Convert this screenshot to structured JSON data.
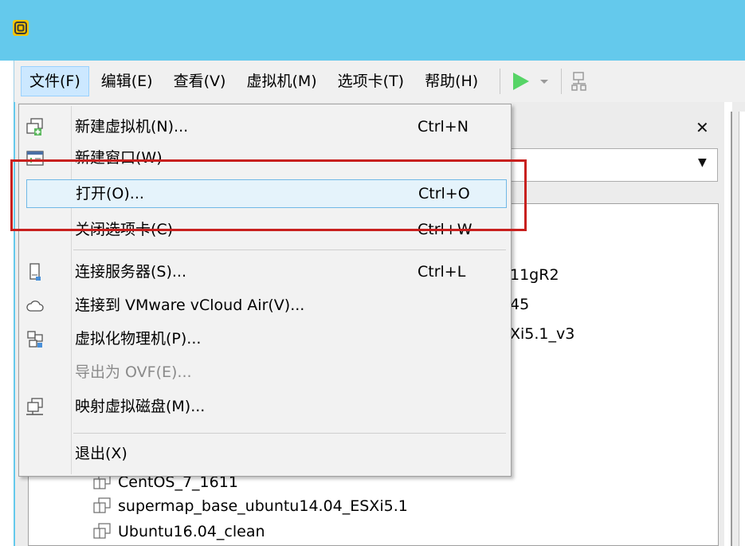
{
  "menubar": {
    "items": [
      {
        "label": "文件(F)"
      },
      {
        "label": "编辑(E)"
      },
      {
        "label": "查看(V)"
      },
      {
        "label": "虚拟机(M)"
      },
      {
        "label": "选项卡(T)"
      },
      {
        "label": "帮助(H)"
      }
    ]
  },
  "file_menu": {
    "items": [
      {
        "label": "新建虚拟机(N)...",
        "shortcut": "Ctrl+N",
        "icon": "new-vm-icon"
      },
      {
        "label": "新建窗口(W)",
        "shortcut": "",
        "icon": "new-window-icon"
      },
      {
        "label": "打开(O)...",
        "shortcut": "Ctrl+O",
        "icon": ""
      },
      {
        "label": "关闭选项卡(C)",
        "shortcut": "Ctrl+W",
        "icon": ""
      },
      {
        "label": "连接服务器(S)...",
        "shortcut": "Ctrl+L",
        "icon": "server-icon"
      },
      {
        "label": "连接到 VMware vCloud Air(V)...",
        "shortcut": "",
        "icon": "cloud-icon"
      },
      {
        "label": "虚拟化物理机(P)...",
        "shortcut": "",
        "icon": "virtualize-physical-icon"
      },
      {
        "label": "导出为 OVF(E)...",
        "shortcut": "",
        "icon": ""
      },
      {
        "label": "映射虚拟磁盘(M)...",
        "shortcut": "",
        "icon": "map-disk-icon"
      },
      {
        "label": "退出(X)",
        "shortcut": "",
        "icon": ""
      }
    ]
  },
  "library": {
    "partial_vm_names": [
      "11gR2",
      "45",
      "Xi5.1_v3"
    ],
    "items": [
      {
        "label": "CentOS_7_1611"
      },
      {
        "label": "supermap_base_ubuntu14.04_ESXi5.1"
      },
      {
        "label": "Ubuntu16.04_clean"
      }
    ]
  },
  "colors": {
    "titlebar": "#64c9ec",
    "annotation": "#c8201e",
    "highlight_border": "#70b8e6",
    "play_green": "#56d466"
  }
}
